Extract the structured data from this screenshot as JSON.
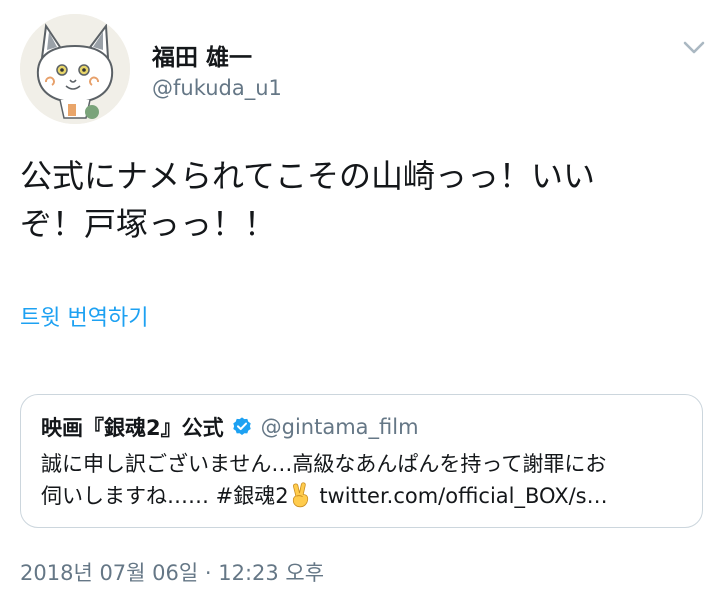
{
  "author": {
    "display_name": "福田 雄一",
    "handle": "@fukuda_u1"
  },
  "more_icon": "chevron-down-icon",
  "tweet": {
    "line1": "公式にナメられてこその山崎っっ！いい",
    "line2": "ぞ！戸塚っっ！！"
  },
  "translate_label": "트윗 번역하기",
  "quoted_tweet": {
    "name": "映画『銀魂2』公式",
    "handle": "@gintama_film",
    "line1": "誠に申し訳ございません…高級なあんぱんを持って謝罪にお",
    "line2_before_emoji": "伺いしますね…… #銀魂2",
    "emoji": "victory-hand-emoji",
    "line2_after_emoji": " twitter.com/official_BOX/s…",
    "verified_icon": "verified-badge-icon"
  },
  "timestamp": "2018년 07월 06일 · 12:23 오후",
  "colors": {
    "link": "#1da1f2",
    "secondary_text": "#657786",
    "border": "#ccd6dd",
    "text": "#14171a"
  }
}
